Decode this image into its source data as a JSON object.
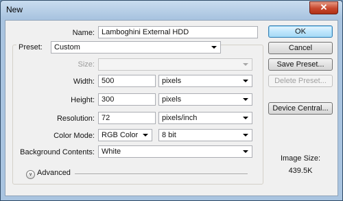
{
  "window": {
    "title": "New",
    "close_glyph": "✕"
  },
  "form": {
    "name_label": "Name:",
    "name_value": "Lamboghini External HDD",
    "preset_label": "Preset:",
    "preset_value": "Custom",
    "size_label": "Size:",
    "size_value": "",
    "width_label": "Width:",
    "width_value": "500",
    "width_unit": "pixels",
    "height_label": "Height:",
    "height_value": "300",
    "height_unit": "pixels",
    "resolution_label": "Resolution:",
    "resolution_value": "72",
    "resolution_unit": "pixels/inch",
    "color_mode_label": "Color Mode:",
    "color_mode_value": "RGB Color",
    "bit_depth_value": "8 bit",
    "background_label": "Background Contents:",
    "background_value": "White",
    "advanced_label": "Advanced",
    "advanced_icon": "chevron-double-down-icon"
  },
  "buttons": {
    "ok": "OK",
    "cancel": "Cancel",
    "save_preset": "Save Preset...",
    "delete_preset": "Delete Preset...",
    "device_central": "Device Central..."
  },
  "image_size": {
    "label": "Image Size:",
    "value": "439.5K"
  }
}
